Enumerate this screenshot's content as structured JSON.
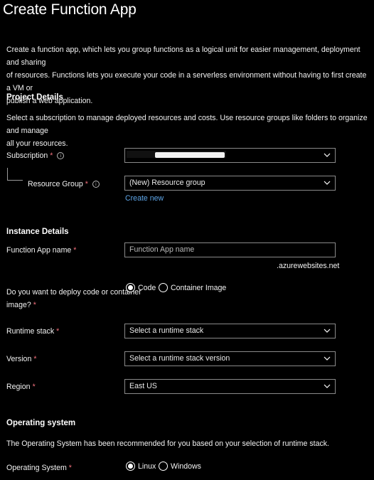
{
  "header": {
    "title": "Create Function App",
    "more_label": "···"
  },
  "intro": {
    "line1": "Create a function app, which lets you group functions as a logical unit for easier management, deployment and sharing",
    "line2": "of resources. Functions lets you execute your code in a serverless environment without having to first create a VM or",
    "line3": "publish a web application."
  },
  "project": {
    "heading": "Project Details",
    "desc_line1": "Select a subscription to manage deployed resources and costs. Use resource groups like folders to organize and manage",
    "desc_line2": "all your resources.",
    "subscription_label": "Subscription",
    "subscription_value": "",
    "resource_group_label": "Resource Group",
    "resource_group_value": "(New) Resource group",
    "create_new": "Create new"
  },
  "instance": {
    "heading": "Instance Details",
    "name_label": "Function App name",
    "name_placeholder": "Function App name",
    "name_suffix": ".azurewebsites.net",
    "deploy_label_line1": "Do you want to deploy code or container",
    "deploy_label_line2": "image?",
    "deploy_options": [
      "Code",
      "Container Image"
    ],
    "deploy_selected": "Code",
    "runtime_label": "Runtime stack",
    "runtime_placeholder": "Select a runtime stack",
    "version_label": "Version",
    "version_placeholder": "Select a runtime stack version",
    "region_label": "Region",
    "region_value": "East US"
  },
  "os": {
    "heading": "Operating system",
    "desc": "The Operating System has been recommended for you based on your selection of runtime stack.",
    "label": "Operating System",
    "options": [
      "Linux",
      "Windows"
    ],
    "selected": "Linux"
  },
  "required_marker": "*",
  "info_glyph": "i",
  "colors": {
    "background": "#000000",
    "text": "#ffffff",
    "required": "#f1707b",
    "link": "#5ea6e8",
    "border": "#8a8a8a"
  }
}
